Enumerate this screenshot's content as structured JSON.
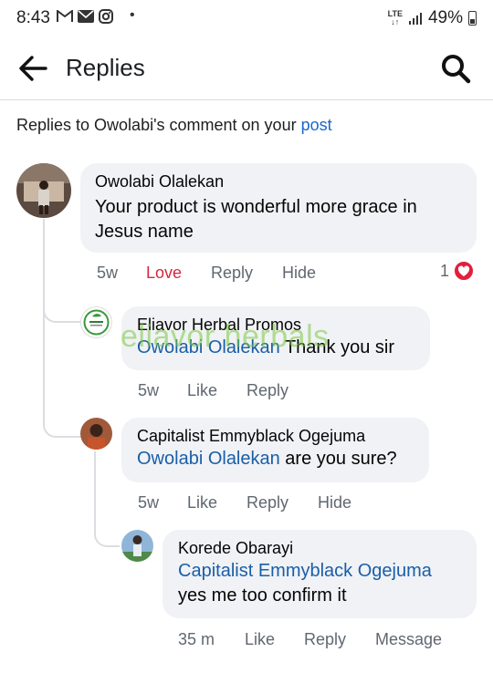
{
  "status_bar": {
    "time": "8:43",
    "left_icons": [
      "gmail-icon",
      "mail-icon",
      "instagram-icon"
    ],
    "dot": "•",
    "network": "LTE",
    "battery": "49%"
  },
  "header": {
    "title": "Replies"
  },
  "context": {
    "prefix": "Replies to Owolabi's comment on your ",
    "link": "post"
  },
  "comments": [
    {
      "author": "Owolabi Olalekan",
      "mention": "",
      "text": "Your product is wonderful more grace in Jesus name",
      "time": "5w",
      "reaction_label": "Love",
      "reply_label": "Reply",
      "hide_label": "Hide",
      "reaction_count": "1"
    },
    {
      "author": "Eliavor Herbal Promos",
      "mention": "Owolabi Olalekan",
      "text": " Thank you sir",
      "time": "5w",
      "like_label": "Like",
      "reply_label": "Reply",
      "avatar_text": "eliavor herbals"
    },
    {
      "author": "Capitalist Emmyblack Ogejuma",
      "mention": "Owolabi Olalekan",
      "text": " are you sure?",
      "time": "5w",
      "like_label": "Like",
      "reply_label": "Reply",
      "hide_label": "Hide"
    },
    {
      "author": "Korede Obarayi",
      "mention": "Capitalist Emmyblack Ogejuma",
      "text": "yes me too confirm it",
      "time": "35 m",
      "like_label": "Like",
      "reply_label": "Reply",
      "message_label": "Message"
    }
  ],
  "watermark": "eliavor herbals",
  "colors": {
    "link": "#1a66cc",
    "mention": "#1a5ea8",
    "love": "#d7263d",
    "bubble": "#f0f2f5",
    "heart": "#e41e3f"
  }
}
